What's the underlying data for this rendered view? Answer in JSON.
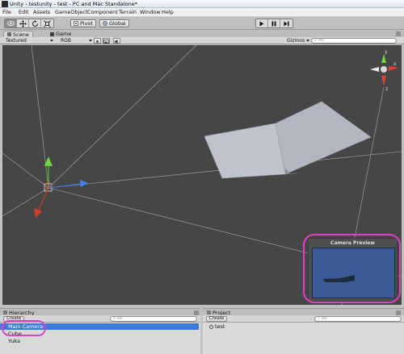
{
  "window": {
    "title": "Unity - testunity - test - PC and Mac Standalone*"
  },
  "menu": [
    "File",
    "Edit",
    "Assets",
    "GameObject",
    "Component",
    "Terrain",
    "Window",
    "Help"
  ],
  "toolbar": {
    "tools": [
      "eye-icon",
      "move-icon",
      "rotate-icon",
      "scale-icon"
    ],
    "pivot_label": "Pivot",
    "global_label": "Global",
    "playback": [
      "play-icon",
      "pause-icon",
      "step-icon"
    ]
  },
  "tabs": {
    "scene": "Scene",
    "game": "Game"
  },
  "scene": {
    "draw_mode": "Textured",
    "render_mode": "RGB",
    "gizmos_label": "Gizmos",
    "search_placeholder": "All",
    "axis_labels": {
      "y": "y",
      "x": "x",
      "z": "z"
    }
  },
  "camera_preview": {
    "title": "Camera Preview"
  },
  "hierarchy": {
    "tab": "Hierarchy",
    "create_label": "Create",
    "search_placeholder": "All",
    "items": [
      "Main Camera",
      "Cube",
      "Yuka"
    ]
  },
  "project": {
    "tab": "Project",
    "create_label": "Create",
    "search_placeholder": "All",
    "items": [
      "test"
    ]
  },
  "colors": {
    "annotation": "#e040c8",
    "selection": "#3d7bd9",
    "viewport_bg": "#464646",
    "preview_bg": "#3c5a95"
  }
}
